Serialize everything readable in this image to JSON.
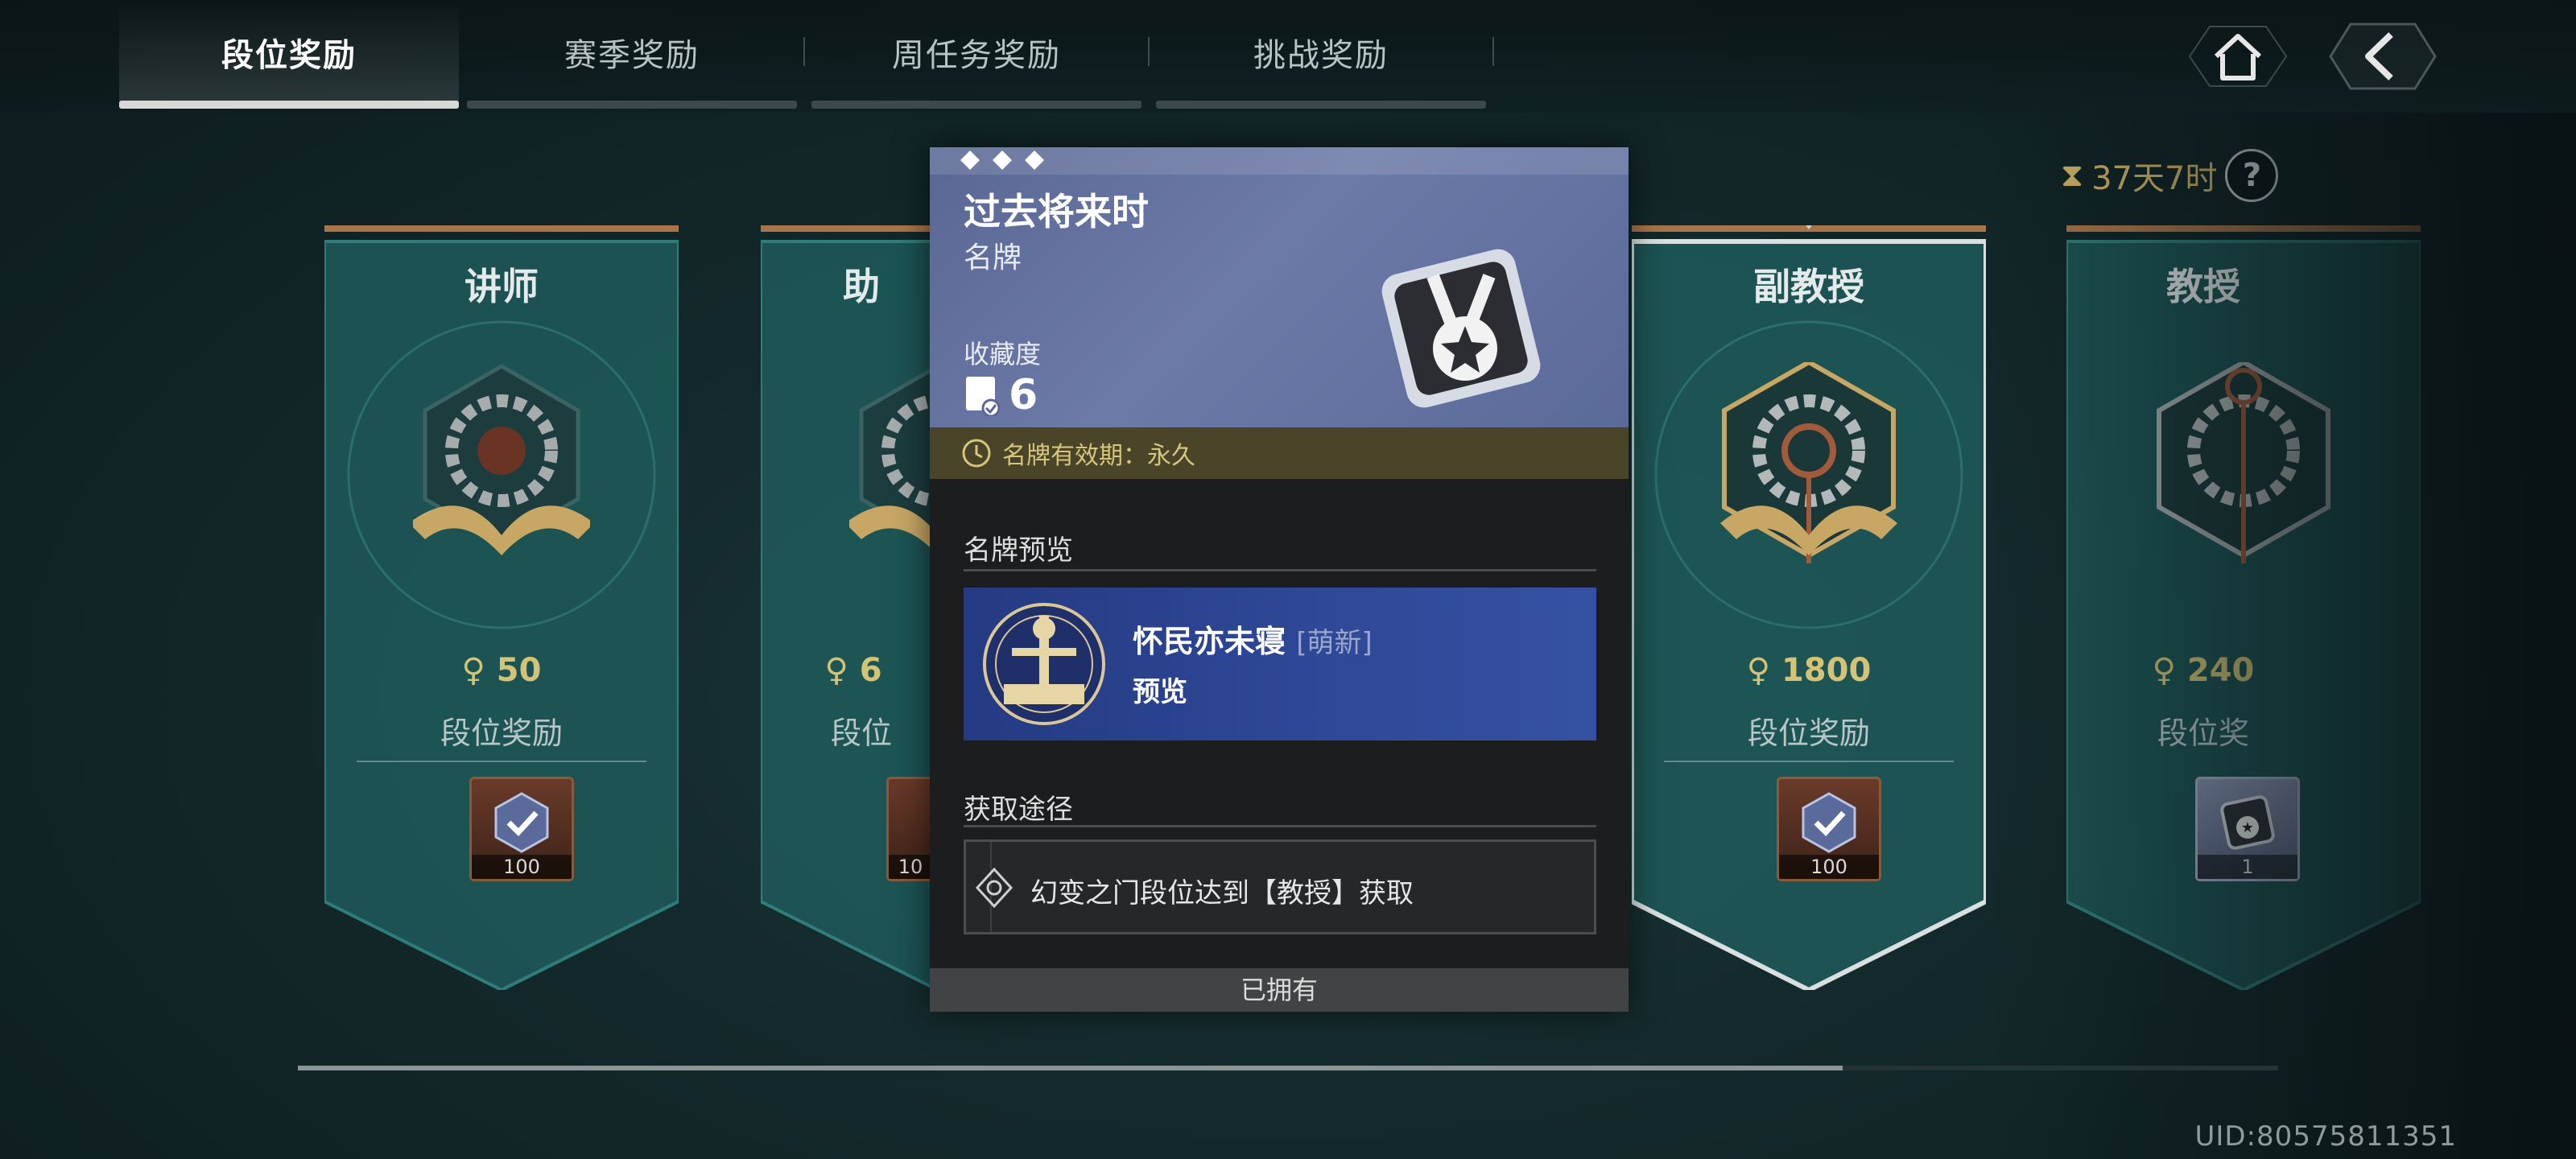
{
  "tabs": [
    {
      "label": "段位奖励",
      "active": true
    },
    {
      "label": "赛季奖励",
      "active": false
    },
    {
      "label": "周任务奖励",
      "active": false
    },
    {
      "label": "挑战奖励",
      "active": false
    }
  ],
  "top_buttons": {
    "home_icon": "home-icon",
    "back_icon": "back-icon"
  },
  "timer": {
    "text": "37天7时",
    "help": "?"
  },
  "ranks": [
    {
      "name": "讲师",
      "points": "50",
      "reward_label": "段位奖励",
      "item_count": "100"
    },
    {
      "name": "助",
      "points": "6",
      "reward_label": "段位",
      "item_count": "10"
    },
    {
      "name": "副教授",
      "points": "1800",
      "reward_label": "段位奖励",
      "item_count": "100"
    },
    {
      "name": "教授",
      "points": "240",
      "reward_label": "段位奖",
      "item_count": "1"
    }
  ],
  "popup": {
    "title": "过去将来时",
    "type": "名牌",
    "collection_label": "收藏度",
    "collection_value": "6",
    "validity": "名牌有效期：永久",
    "preview_section": "名牌预览",
    "preview_name": "怀民亦未寝",
    "preview_tag": "[萌新]",
    "preview_button": "预览",
    "source_section": "获取途径",
    "source_text": "幻变之门段位达到【教授】获取",
    "owned": "已拥有"
  },
  "progress": {
    "value": 0.78
  },
  "uid": "UID:80575811351",
  "colors": {
    "accent_gold": "#d4c376",
    "popup_header": "#6c7aa8",
    "validity_bar": "#4a4529",
    "preview_bg": "#2e4795"
  }
}
